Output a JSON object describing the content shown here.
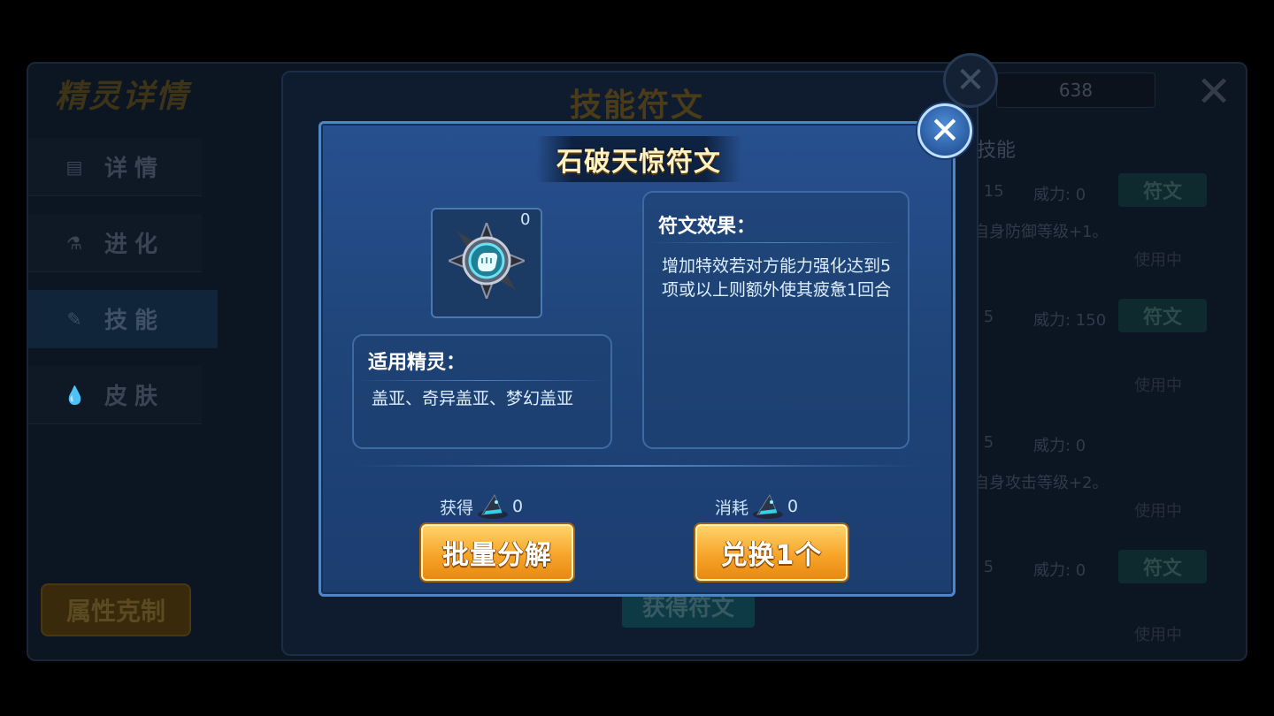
{
  "background": {
    "title": "精灵详情",
    "tabs": [
      {
        "icon": "document-icon",
        "label": "详情"
      },
      {
        "icon": "flask-icon",
        "label": "进化"
      },
      {
        "icon": "skill-icon",
        "label": "技能"
      },
      {
        "icon": "drop-icon",
        "label": "皮肤"
      }
    ],
    "attr_button": "属性克制",
    "counter": "638",
    "skills_heading": "技能",
    "skills": [
      {
        "pp": ": 15",
        "power": "威力: 0",
        "rune": "符文",
        "desc": "自身防御等级+1。",
        "status": "使用中"
      },
      {
        "pp": ": 5",
        "power": "威力: 150",
        "rune": "符文",
        "desc": "",
        "status": "使用中"
      },
      {
        "pp": ": 5",
        "power": "威力: 0",
        "rune": "",
        "desc": "自身攻击等级+2。",
        "status": "使用中"
      },
      {
        "pp": ": 5",
        "power": "威力: 0",
        "rune": "符文",
        "desc": "",
        "status": "使用中"
      }
    ]
  },
  "middle": {
    "title": "技能符文",
    "get_button": "获得符文"
  },
  "dialog": {
    "title": "石破天惊符文",
    "rune_count": "0",
    "applicable": {
      "heading": "适用精灵：",
      "text": "盖亚、奇异盖亚、梦幻盖亚"
    },
    "effect": {
      "heading": "符文效果：",
      "text": "增加特效若对方能力强化达到5项或以上则额外使其疲惫1回合"
    },
    "obtain": {
      "label": "获得",
      "count": "0",
      "icon": "wizard-hat-icon"
    },
    "consume": {
      "label": "消耗",
      "count": "0",
      "icon": "wizard-hat-icon"
    },
    "batch_button": "批量分解",
    "exchange_button": "兑换1个"
  },
  "colors": {
    "dialog_bg": "#27508f",
    "dialog_border": "#4e86c8",
    "button_orange": "#f7a52a",
    "title_text": "#fff1c2"
  }
}
